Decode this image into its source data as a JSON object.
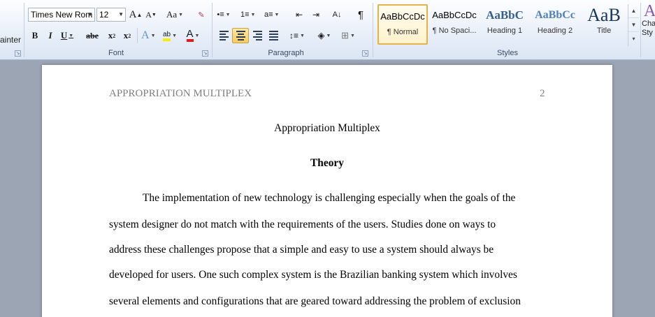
{
  "ribbon": {
    "clipboard": {
      "format_painter_label": "ainter"
    },
    "font": {
      "label": "Font",
      "font_name": "Times New Rom",
      "font_size": "12",
      "grow_label": "A",
      "shrink_label": "A",
      "change_case_label": "Aa",
      "bold": "B",
      "italic": "I",
      "underline": "U",
      "strike": "abe",
      "subscript": "x",
      "superscript": "x",
      "text_effects": "A",
      "highlight": "ab",
      "font_color": "A"
    },
    "paragraph": {
      "label": "Paragraph",
      "pilcrow": "¶"
    },
    "styles": {
      "label": "Styles",
      "items": [
        {
          "sample": "AaBbCcDc",
          "name": "¶ Normal"
        },
        {
          "sample": "AaBbCcDc",
          "name": "¶ No Spaci..."
        },
        {
          "sample": "AaBbC",
          "name": "Heading 1"
        },
        {
          "sample": "AaBbCc",
          "name": "Heading 2"
        },
        {
          "sample": "AaB",
          "name": "Title"
        }
      ],
      "change_label_1": "Cha",
      "change_label_2": "Sty"
    }
  },
  "document": {
    "header": "APPROPRIATION MULTIPLEX",
    "page_number": "2",
    "title": "Appropriation Multiplex",
    "heading": "Theory",
    "lines": [
      "The implementation of new technology is challenging  especially  when the goals of the",
      "system designer  do not match with the requirements  of the users.  Studies done on ways to",
      "address these challenges  propose that a simple  and easy to use a system  should always be",
      "developed  for users.  One such complex system is the Brazilian  banking system which involves",
      "several elements  and configurations  that are geared toward addressing the problem  of exclusion"
    ]
  },
  "colors": {
    "accent": "#e5b34a",
    "ribbon_bg": "#dbe5f3",
    "workspace": "#9ba5b3"
  }
}
